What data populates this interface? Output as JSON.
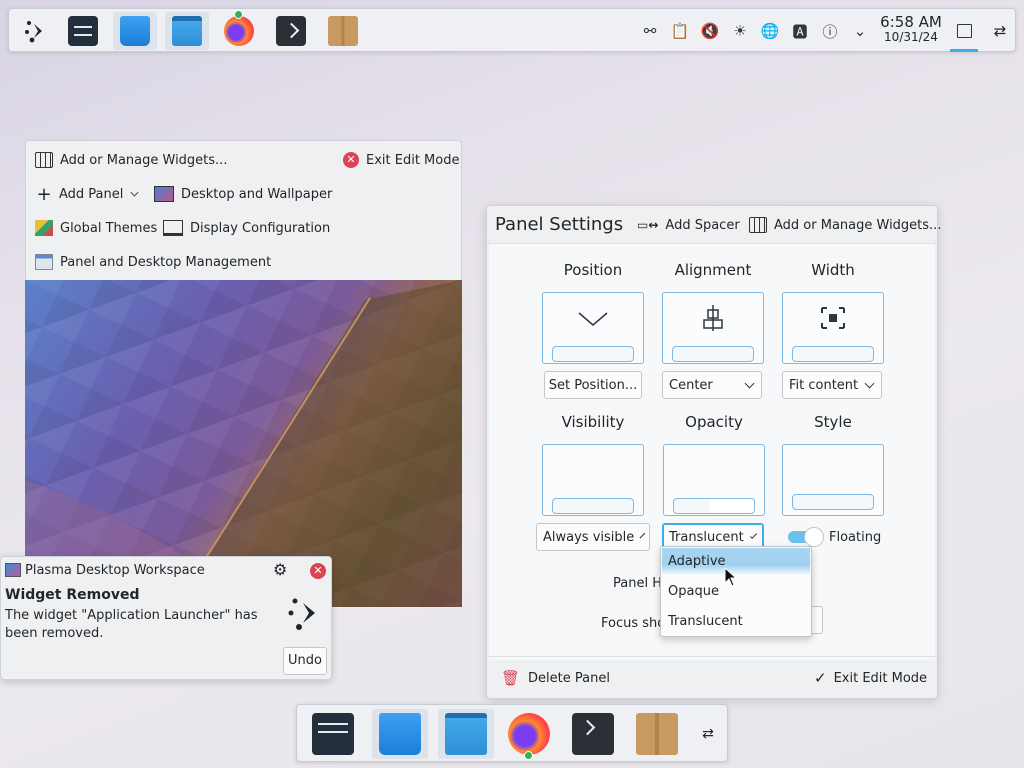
{
  "top_panel": {
    "clock_time": "6:58 AM",
    "clock_date": "10/31/24",
    "tray_icons": [
      "network-connect-icon",
      "clipboard-icon",
      "volume-muted-icon",
      "brightness-icon",
      "network-globe-icon",
      "text-editor-icon",
      "updates-icon",
      "expand-tray-icon"
    ]
  },
  "edit_toolbar": {
    "add_widgets": "Add or Manage Widgets...",
    "exit_edit_mode": "Exit Edit Mode",
    "add_panel": "Add Panel",
    "desktop_wallpaper": "Desktop and Wallpaper",
    "global_themes": "Global Themes",
    "display_configuration": "Display Configuration",
    "panel_desktop_management": "Panel and Desktop Management"
  },
  "panel_settings": {
    "title": "Panel Settings",
    "add_spacer": "Add Spacer",
    "add_widgets": "Add or Manage Widgets...",
    "position_label": "Position",
    "alignment_label": "Alignment",
    "width_label": "Width",
    "visibility_label": "Visibility",
    "opacity_label": "Opacity",
    "style_label": "Style",
    "set_position": "Set Position...",
    "alignment_value": "Center",
    "width_value": "Fit content",
    "visibility_value": "Always visible",
    "opacity_value": "Translucent",
    "floating_label": "Floating",
    "floating_on": true,
    "panel_height_partial": "Panel He",
    "focus_partial": "Focus sho",
    "delete_panel": "Delete Panel",
    "exit_edit_mode": "Exit Edit Mode"
  },
  "opacity_dropdown": {
    "options": [
      "Adaptive",
      "Opaque",
      "Translucent"
    ],
    "highlighted": "Adaptive"
  },
  "notification": {
    "app_name": "Plasma Desktop Workspace",
    "title": "Widget Removed",
    "body": "The widget \"Application Launcher\" has been removed.",
    "undo": "Undo"
  },
  "colors": {
    "accent": "#3daee9",
    "close_red": "#da4453",
    "panel_bg": "#eff0f1"
  }
}
